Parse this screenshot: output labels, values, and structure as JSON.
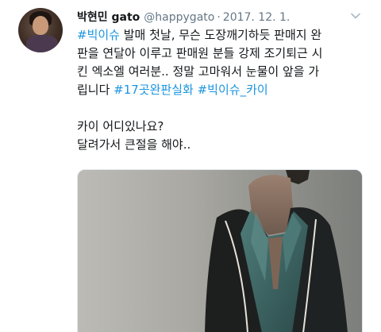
{
  "tweet": {
    "display_name": "박현민 gato",
    "handle": "@happygato",
    "separator": "·",
    "date": "2017. 12. 1.",
    "text_lines": [
      [
        {
          "text": "#빅이슈",
          "type": "hashtag"
        },
        {
          "text": " 발매 첫날, 무슨 도장깨기하듯 판매지 완",
          "type": "text"
        }
      ],
      [
        {
          "text": "판을 연달아 이루고 판매원 분들 강제 조기퇴근 시",
          "type": "text"
        }
      ],
      [
        {
          "text": "킨 엑소엘 여러분.. 정말 고마워서 눈물이 앞을 가",
          "type": "text"
        }
      ],
      [
        {
          "text": "립니다 ",
          "type": "text"
        },
        {
          "text": "#17곳완판실화",
          "type": "hashtag"
        },
        {
          "text": " ",
          "type": "text"
        },
        {
          "text": "#빅이슈_카이",
          "type": "hashtag"
        }
      ]
    ],
    "text_lines_2": [
      "카이 어디있나요?",
      "달려가서 큰절을 해야.."
    ]
  },
  "icons": {
    "caret": "chevron-down-icon",
    "avatar": "profile-avatar"
  },
  "colors": {
    "hashtag": "#1b95e0",
    "secondary_text": "#657786",
    "primary_text": "#14171a"
  }
}
